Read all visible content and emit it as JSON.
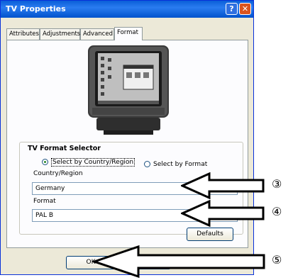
{
  "window": {
    "title": "TV Properties",
    "help_glyph": "?",
    "close_glyph": "✕"
  },
  "tabs": [
    {
      "label": "Attributes"
    },
    {
      "label": "Adjustments"
    },
    {
      "label": "Advanced"
    },
    {
      "label": "Format"
    }
  ],
  "format_selector": {
    "title": "TV Format Selector",
    "radio_country": "Select by Country/Region",
    "radio_format": "Select by Format",
    "selected": "Select by Country/Region",
    "country_label": "Country/Region",
    "country_value": "Germany",
    "format_label": "Format",
    "format_value": "PAL B",
    "defaults_label": "Defaults"
  },
  "buttons": {
    "ok_label": "OK"
  },
  "callouts": [
    "③",
    "④",
    "⑤"
  ],
  "colors": {
    "titlebar": "#0a5fd8",
    "window_bg": "#ece9d8",
    "panel_bg": "#fcfcfe"
  }
}
